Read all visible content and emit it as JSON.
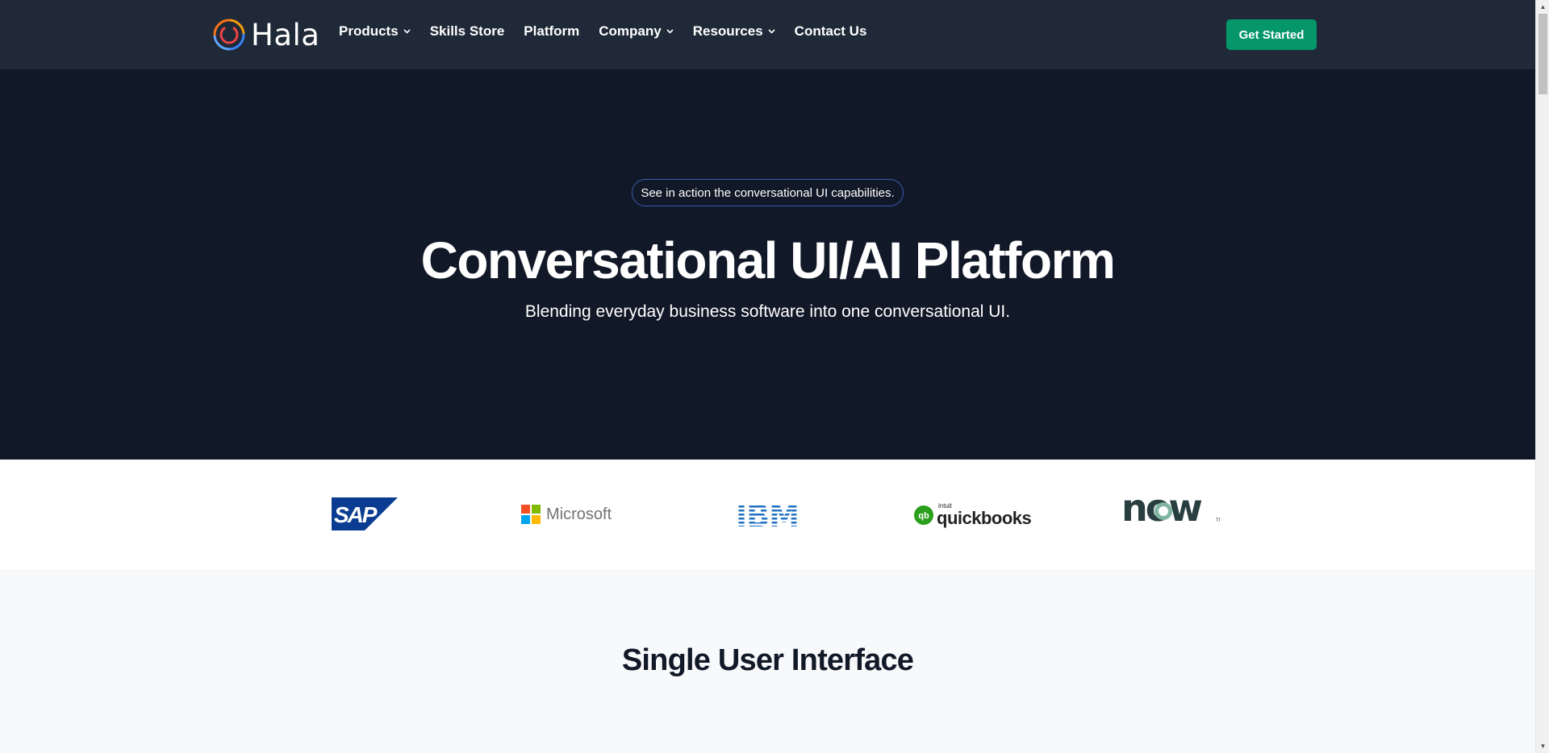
{
  "nav": {
    "logo_text": "Hala",
    "items": [
      {
        "label": "Products",
        "has_dropdown": true
      },
      {
        "label": "Skills Store",
        "has_dropdown": false
      },
      {
        "label": "Platform",
        "has_dropdown": false
      },
      {
        "label": "Company",
        "has_dropdown": true
      },
      {
        "label": "Resources",
        "has_dropdown": true
      },
      {
        "label": "Contact Us",
        "has_dropdown": false
      }
    ],
    "cta_label": "Get Started"
  },
  "hero": {
    "pill_text": "See in action the conversational UI capabilities.",
    "title": "Conversational UI/AI Platform",
    "subtitle": "Blending everyday business software into one conversational UI."
  },
  "brands": {
    "sap": "SAP",
    "microsoft": "Microsoft",
    "ibm": "IBM",
    "quickbooks_prefix": "intuit",
    "quickbooks": "quickbooks",
    "servicenow": "now"
  },
  "section2": {
    "title": "Single User Interface"
  },
  "colors": {
    "nav_bg": "#1f2937",
    "hero_bg": "#111827",
    "cta": "#059669",
    "sap_blue": "#0a3d91",
    "ibm_blue": "#1f70c1",
    "qb_green": "#2ca01c",
    "now_dark": "#293e40",
    "now_green": "#81b5a1"
  }
}
